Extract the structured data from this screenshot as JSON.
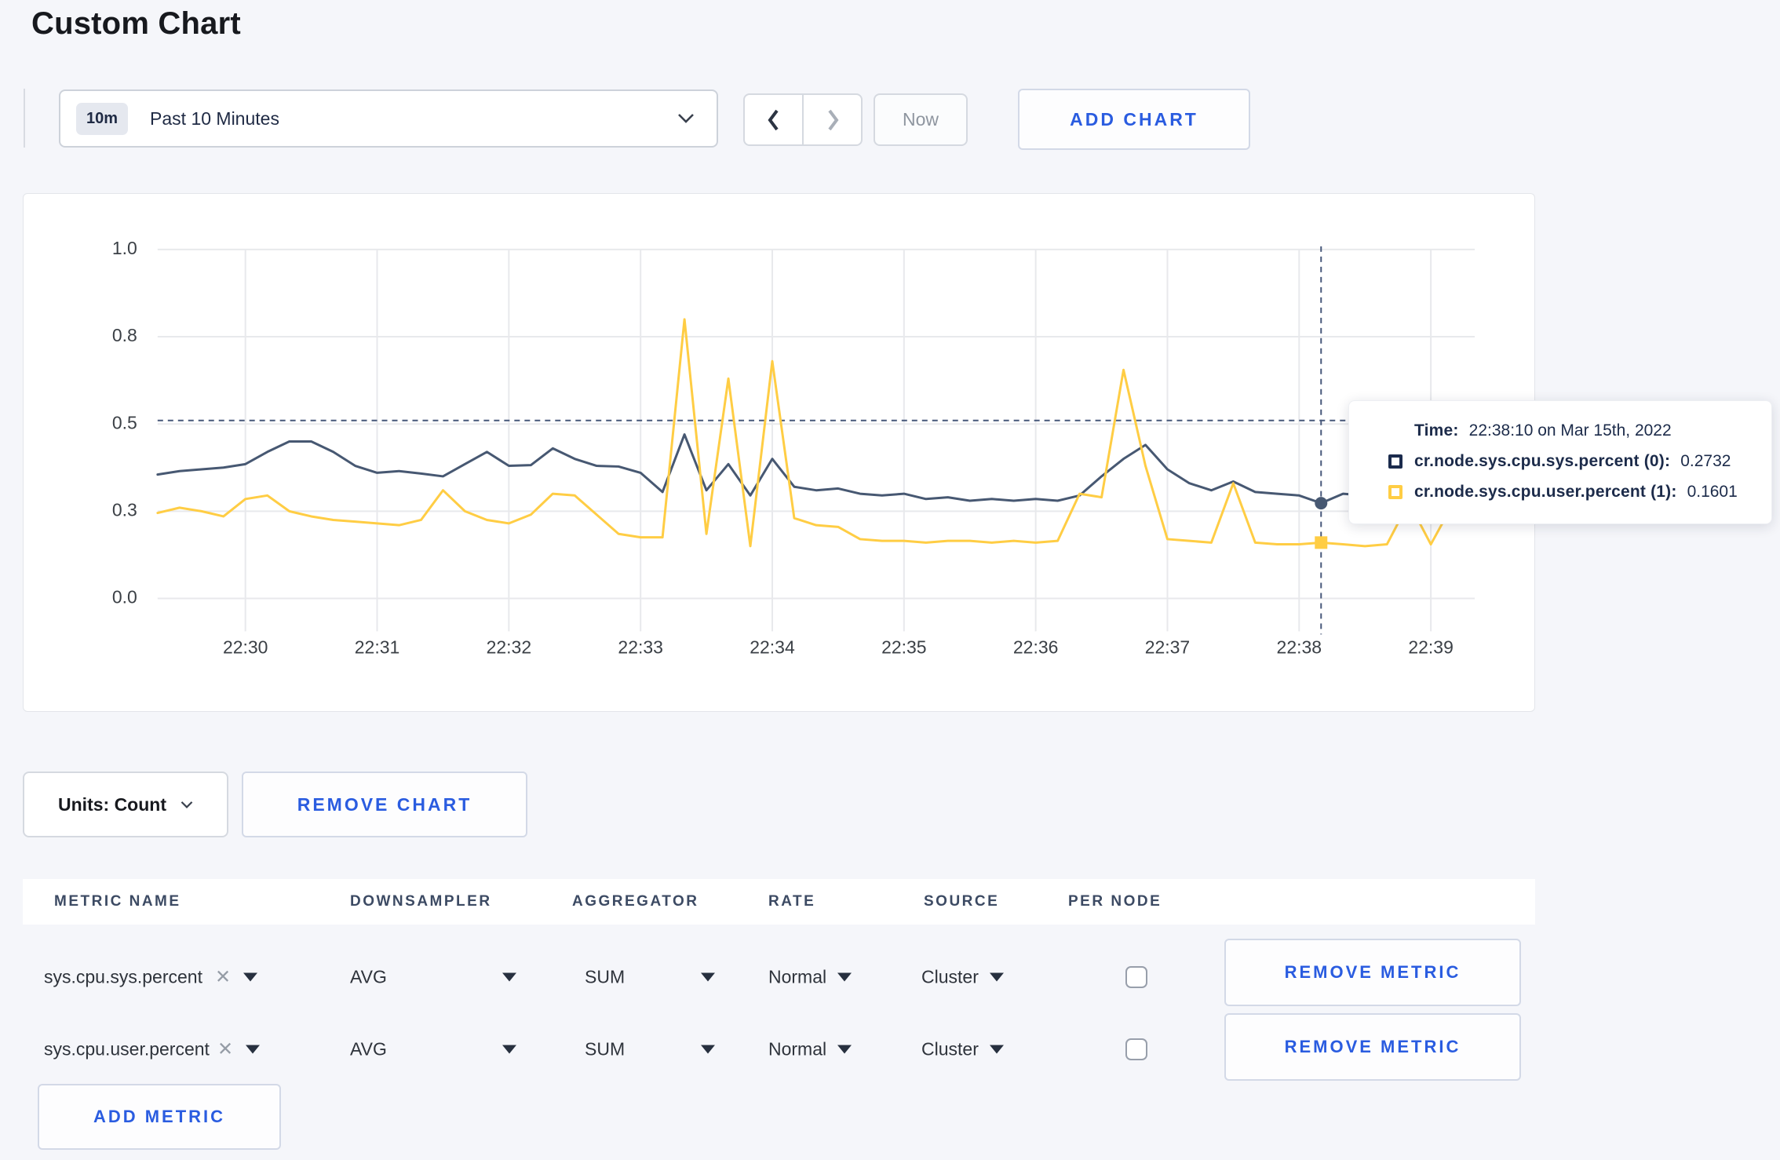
{
  "page": {
    "title": "Custom Chart",
    "background": "#f5f6fa",
    "accent_blue": "#2a5ce0"
  },
  "toolbar": {
    "time_range": {
      "badge": "10m",
      "label": "Past 10 Minutes"
    },
    "now_label": "Now",
    "add_chart_label": "ADD CHART"
  },
  "chart_data": {
    "type": "line",
    "title": "",
    "xlabel": "",
    "ylabel": "",
    "ylim": [
      0,
      1
    ],
    "grid": true,
    "x_domain": [
      "22:29:20",
      "22:39:20"
    ],
    "x_ticks": [
      "22:30",
      "22:31",
      "22:32",
      "22:33",
      "22:34",
      "22:35",
      "22:36",
      "22:37",
      "22:38",
      "22:39"
    ],
    "y_ticks": [
      {
        "label": "0.0",
        "frac": 0.0
      },
      {
        "label": "0.3",
        "frac": 0.25
      },
      {
        "label": "0.5",
        "frac": 0.5
      },
      {
        "label": "0.8",
        "frac": 0.75
      },
      {
        "label": "1.0",
        "frac": 1.0
      }
    ],
    "sample_start": "22:29:20",
    "sample_step_seconds": 10,
    "series": [
      {
        "name": "cr.node.sys.cpu.sys.percent",
        "color": "#475872",
        "marker": "circle",
        "values": [
          0.355,
          0.365,
          0.37,
          0.375,
          0.385,
          0.42,
          0.45,
          0.45,
          0.42,
          0.38,
          0.36,
          0.365,
          0.358,
          0.35,
          0.385,
          0.42,
          0.38,
          0.382,
          0.43,
          0.4,
          0.38,
          0.378,
          0.36,
          0.305,
          0.47,
          0.31,
          0.385,
          0.295,
          0.4,
          0.32,
          0.31,
          0.315,
          0.3,
          0.295,
          0.3,
          0.285,
          0.29,
          0.28,
          0.285,
          0.28,
          0.285,
          0.28,
          0.295,
          0.35,
          0.4,
          0.44,
          0.37,
          0.33,
          0.31,
          0.335,
          0.305,
          0.3,
          0.295,
          0.273,
          0.3,
          0.295,
          0.33,
          0.31,
          0.295,
          0.305
        ]
      },
      {
        "name": "cr.node.sys.cpu.user.percent",
        "color": "#ffcd44",
        "marker": "square",
        "values": [
          0.245,
          0.26,
          0.25,
          0.235,
          0.285,
          0.295,
          0.25,
          0.235,
          0.225,
          0.22,
          0.215,
          0.21,
          0.225,
          0.31,
          0.25,
          0.225,
          0.215,
          0.24,
          0.3,
          0.295,
          0.24,
          0.185,
          0.175,
          0.175,
          0.8,
          0.185,
          0.63,
          0.15,
          0.68,
          0.23,
          0.21,
          0.205,
          0.17,
          0.165,
          0.165,
          0.16,
          0.165,
          0.165,
          0.16,
          0.165,
          0.16,
          0.165,
          0.3,
          0.29,
          0.655,
          0.38,
          0.17,
          0.165,
          0.16,
          0.33,
          0.16,
          0.155,
          0.155,
          0.16,
          0.155,
          0.15,
          0.155,
          0.275,
          0.155,
          0.27
        ]
      }
    ],
    "crosshair": {
      "time": "22:38:10",
      "h_line_value": 0.51
    },
    "gridline_color": "#e8e9ec",
    "axis_text_color": "#3b4046",
    "crosshair_color": "#47587a"
  },
  "tooltip": {
    "time_label": "Time:",
    "time_value": "22:38:10 on Mar 15th, 2022",
    "rows": [
      {
        "label": "cr.node.sys.cpu.sys.percent (0):",
        "value": "0.2732",
        "color": "#1b2b4d"
      },
      {
        "label": "cr.node.sys.cpu.user.percent (1):",
        "value": "0.1601",
        "color": "#ffcd44"
      }
    ]
  },
  "chart_footer": {
    "units_label": "Units: Count",
    "remove_chart_label": "REMOVE CHART"
  },
  "metrics_table": {
    "headers": [
      "METRIC NAME",
      "DOWNSAMPLER",
      "AGGREGATOR",
      "RATE",
      "SOURCE",
      "PER NODE"
    ],
    "rows": [
      {
        "metric": "sys.cpu.sys.percent",
        "downsampler": "AVG",
        "aggregator": "SUM",
        "rate": "Normal",
        "source": "Cluster",
        "per_node_checked": false,
        "remove_label": "REMOVE METRIC"
      },
      {
        "metric": "sys.cpu.user.percent",
        "downsampler": "AVG",
        "aggregator": "SUM",
        "rate": "Normal",
        "source": "Cluster",
        "per_node_checked": false,
        "remove_label": "REMOVE METRIC"
      }
    ],
    "add_metric_label": "ADD METRIC"
  }
}
